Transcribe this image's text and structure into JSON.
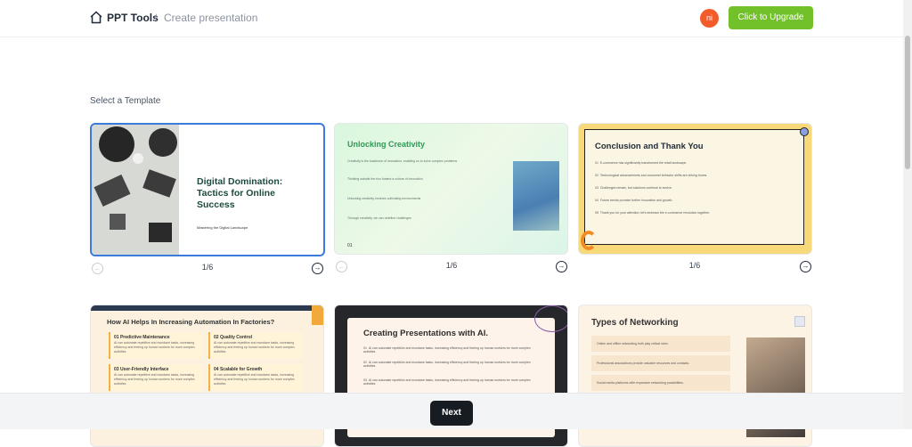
{
  "header": {
    "brand": "PPT Tools",
    "separator": "/",
    "page": "Create presentation",
    "avatar_initials": "ni",
    "upgrade_label": "Click to Upgrade",
    "accent_upgrade": "#72c12a",
    "avatar_color": "#f45b2b"
  },
  "section_title": "Select a Template",
  "templates": [
    {
      "title": "Digital Domination: Tactics for Online Success",
      "subtitle": "Mastering the Digital Landscape",
      "pager": "1/6",
      "selected": true
    },
    {
      "title": "Unlocking Creativity",
      "lines": [
        "Creativity is the backbone of innovation, enabling us to solve complex problems",
        "Thinking outside the box fosters a culture of innovation",
        "Unlocking creativity involves cultivating environments",
        "Through creativity, we can redefine challenges"
      ],
      "slide_number": "01",
      "pager": "1/6",
      "selected": false
    },
    {
      "title": "Conclusion and Thank You",
      "lines": [
        "E-commerce has significantly transformed the retail landscape.",
        "Technological advancements and consumer behavior shifts are driving forces.",
        "Challenges remain, but solutions continue to evolve.",
        "Future trends promise further innovation and growth.",
        "Thank you for your attention; let's embrace the e-commerce revolution together."
      ],
      "numbers": [
        "01",
        "02",
        "03",
        "04",
        "05"
      ],
      "pager": "1/6",
      "selected": false
    },
    {
      "title": "How AI Helps In Increasing Automation In Factories?",
      "boxes": [
        {
          "title": "01 Predictive Maintenance",
          "text": "AI can automate repetitive and mundane tasks, increasing efficiency and freeing up human workers for more complex activities"
        },
        {
          "title": "02 Quality Control",
          "text": "AI can automate repetitive and mundane tasks, increasing efficiency and freeing up human workers for more complex activities"
        },
        {
          "title": "03 User-Friendly Interface",
          "text": "AI can automate repetitive and mundane tasks, increasing efficiency and freeing up human workers for more complex activities"
        },
        {
          "title": "04 Scalable for Growth",
          "text": "AI can automate repetitive and mundane tasks, increasing efficiency and freeing up human workers for more complex activities"
        }
      ]
    },
    {
      "title": "Creating Presentations with AI.",
      "numbers": [
        "01",
        "02",
        "03"
      ],
      "line": "AI can automate repetitive and mundane tasks, increasing efficiency and freeing up human workers for more complex activities"
    },
    {
      "title": "Types of Networking",
      "rows": [
        "Online and offline networking both play critical roles.",
        "Professional associations provide valuable resources and contacts.",
        "Social media platforms offer expansive networking possibilities."
      ]
    }
  ],
  "footer": {
    "next_label": "Next"
  },
  "icons": {
    "home": "home-icon",
    "prev": "arrow-left-circle-icon",
    "next": "arrow-right-circle-icon"
  }
}
